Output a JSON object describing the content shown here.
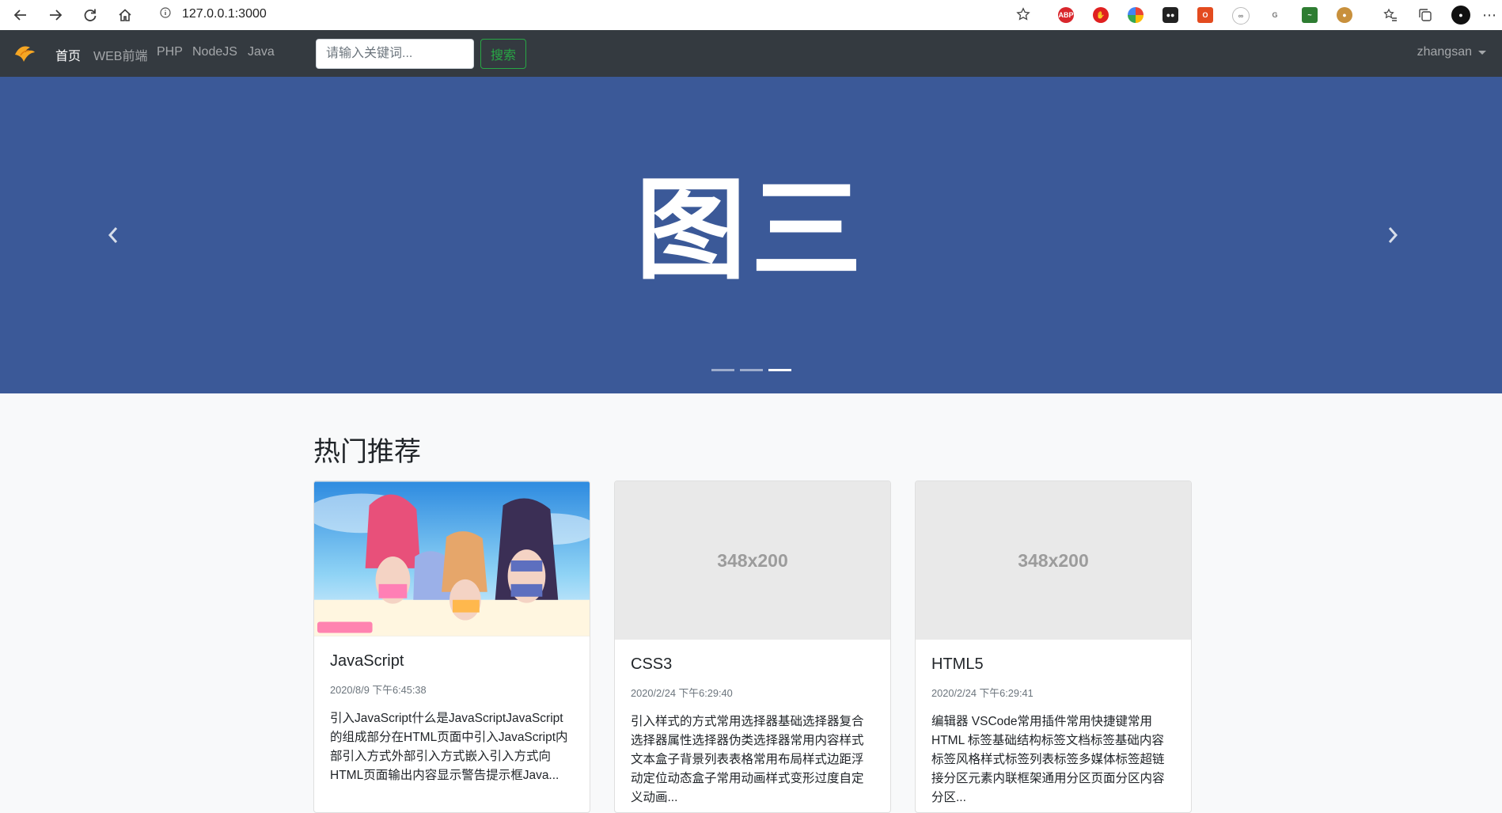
{
  "browser": {
    "url": "127.0.0.1:3000"
  },
  "navbar": {
    "items": [
      {
        "label": "首页",
        "active": true
      },
      {
        "label": "WEB前端",
        "active": false
      },
      {
        "label": "PHP",
        "active": false
      },
      {
        "label": "NodeJS",
        "active": false
      },
      {
        "label": "Java",
        "active": false
      }
    ],
    "search_placeholder": "请输入关键词...",
    "search_button": "搜索",
    "username": "zhangsan"
  },
  "carousel": {
    "slide_text": "图三",
    "slide_count": 3,
    "active_index": 2
  },
  "section": {
    "title": "热门推荐"
  },
  "cards": [
    {
      "title": "JavaScript",
      "date": "2020/8/9 下午6:45:38",
      "text": "引入JavaScript什么是JavaScriptJavaScript的组成部分在HTML页面中引入JavaScript内部引入方式外部引入方式嵌入引入方式向HTML页面输出内容显示警告提示框Java...",
      "image": "photo"
    },
    {
      "title": "CSS3",
      "date": "2020/2/24 下午6:29:40",
      "text": "引入样式的方式常用选择器基础选择器复合选择器属性选择器伪类选择器常用内容样式文本盒子背景列表表格常用布局样式边距浮动定位动态盒子常用动画样式变形过度自定义动画...",
      "image": "348x200"
    },
    {
      "title": "HTML5",
      "date": "2020/2/24 下午6:29:41",
      "text": "编辑器 VSCode常用插件常用快捷键常用 HTML 标签基础结构标签文档标签基础内容标签风格样式标签列表标签多媒体标签超链接分区元素内联框架通用分区页面分区内容分区...",
      "image": "348x200"
    }
  ],
  "colors": {
    "navbar_bg": "#343a40",
    "carousel_bg": "#3b5998",
    "success": "#28a745"
  }
}
